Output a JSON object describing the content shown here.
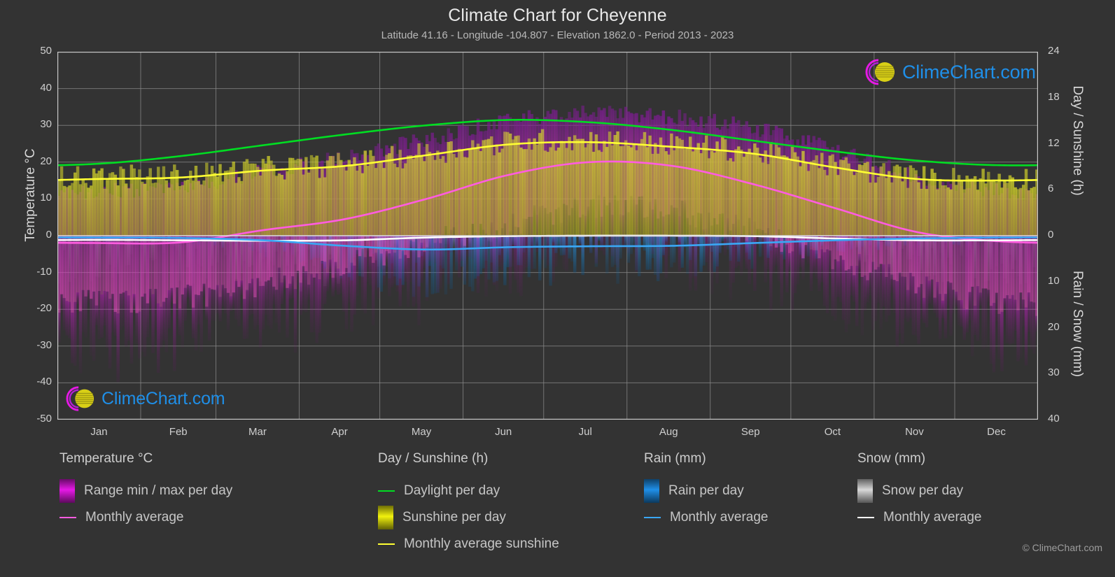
{
  "header": {
    "title": "Climate Chart for Cheyenne",
    "subtitle": "Latitude 41.16 - Longitude -104.807 - Elevation 1862.0 - Period 2013 - 2023"
  },
  "watermark": {
    "text": "ClimeChart.com"
  },
  "copyright": "© ClimeChart.com",
  "axes": {
    "left_title": "Temperature °C",
    "right_top_title": "Day / Sunshine (h)",
    "right_bottom_title": "Rain / Snow (mm)",
    "left_ticks": [
      "50",
      "40",
      "30",
      "20",
      "10",
      "0",
      "-10",
      "-20",
      "-30",
      "-40",
      "-50"
    ],
    "right_top_ticks": [
      "24",
      "18",
      "12",
      "6",
      "0"
    ],
    "right_bottom_ticks": [
      "0",
      "10",
      "20",
      "30",
      "40"
    ],
    "x_ticks": [
      "Jan",
      "Feb",
      "Mar",
      "Apr",
      "May",
      "Jun",
      "Jul",
      "Aug",
      "Sep",
      "Oct",
      "Nov",
      "Dec"
    ]
  },
  "colors": {
    "background": "#333333",
    "grid": "#8a8a8a",
    "axis": "#c8c8c8",
    "temp_range": "#e619e6",
    "temp_avg": "#ff5ce0",
    "daylight": "#00dd22",
    "sunshine": "#f2f20d",
    "sunshine_avg": "#ffff33",
    "rain": "#1f8fe8",
    "rain_avg": "#3aa7f5",
    "snow": "#d8d8d8",
    "snow_avg": "#ffffff",
    "logo_text": "#1f8fe8",
    "logo_arc": "#e619e6",
    "logo_sphere": "#e8e017"
  },
  "legend": {
    "columns": [
      {
        "title": "Temperature °C",
        "items": [
          {
            "type": "gradient",
            "label": "Range min / max per day",
            "color": "#e619e6"
          },
          {
            "type": "line",
            "label": "Monthly average",
            "color": "#ff5ce0"
          }
        ]
      },
      {
        "title": "Day / Sunshine (h)",
        "items": [
          {
            "type": "line",
            "label": "Daylight per day",
            "color": "#00dd22"
          },
          {
            "type": "gradient",
            "label": "Sunshine per day",
            "color": "#f2f20d"
          },
          {
            "type": "line",
            "label": "Monthly average sunshine",
            "color": "#ffff33"
          }
        ]
      },
      {
        "title": "Rain (mm)",
        "items": [
          {
            "type": "gradient",
            "label": "Rain per day",
            "color": "#1f8fe8"
          },
          {
            "type": "line",
            "label": "Monthly average",
            "color": "#3aa7f5"
          }
        ]
      },
      {
        "title": "Snow (mm)",
        "items": [
          {
            "type": "gradient",
            "label": "Snow per day",
            "color": "#d8d8d8"
          },
          {
            "type": "line",
            "label": "Monthly average",
            "color": "#ffffff"
          }
        ]
      }
    ]
  },
  "chart_data": {
    "type": "area",
    "title": "Climate Chart for Cheyenne",
    "subtitle": "Latitude 41.16 - Longitude -104.807 - Elevation 1862.0 - Period 2013 - 2023",
    "xlabel": "",
    "ylabel": "Temperature °C",
    "ylim": [
      -50,
      50
    ],
    "y2lim_top": [
      0,
      24
    ],
    "y2lim_bottom": [
      0,
      40
    ],
    "grid": true,
    "legend_position": "below",
    "categories": [
      "Jan",
      "Feb",
      "Mar",
      "Apr",
      "May",
      "Jun",
      "Jul",
      "Aug",
      "Sep",
      "Oct",
      "Nov",
      "Dec"
    ],
    "series": [
      {
        "name": "Temperature monthly average (°C)",
        "units": "°C",
        "color": "#ff5ce0",
        "values": [
          -2.0,
          -1.8,
          1.5,
          4.5,
          10.0,
          16.5,
          20.0,
          19.0,
          14.0,
          7.5,
          1.0,
          -1.5
        ]
      },
      {
        "name": "Temperature daily max envelope (°C)",
        "units": "°C",
        "color": "#e619e6",
        "values": [
          12.0,
          13.0,
          17.0,
          21.0,
          26.0,
          31.0,
          33.0,
          32.0,
          29.0,
          23.0,
          16.0,
          12.0
        ]
      },
      {
        "name": "Temperature daily min envelope (°C)",
        "units": "°C",
        "color": "#e619e6",
        "values": [
          -18.0,
          -17.0,
          -13.0,
          -8.0,
          -2.0,
          3.0,
          8.0,
          7.0,
          1.0,
          -6.0,
          -13.0,
          -18.0
        ]
      },
      {
        "name": "Daylight per day (h)",
        "units": "h",
        "color": "#00dd22",
        "values": [
          9.4,
          10.4,
          11.8,
          13.2,
          14.4,
          15.1,
          14.8,
          13.8,
          12.4,
          11.0,
          9.8,
          9.2
        ]
      },
      {
        "name": "Monthly average sunshine (h)",
        "units": "h",
        "color": "#ffff33",
        "values": [
          7.4,
          7.6,
          8.5,
          9.1,
          10.5,
          11.9,
          12.2,
          11.6,
          10.7,
          8.9,
          7.4,
          7.2
        ]
      },
      {
        "name": "Rain monthly average (mm)",
        "units": "mm",
        "color": "#3aa7f5",
        "values": [
          0.4,
          0.5,
          1.0,
          2.2,
          3.0,
          2.5,
          2.3,
          2.2,
          1.6,
          1.0,
          0.6,
          0.4
        ]
      },
      {
        "name": "Snow monthly average (mm)",
        "units": "mm",
        "color": "#ffffff",
        "values": [
          0.9,
          1.0,
          1.1,
          1.0,
          0.4,
          0.1,
          0.0,
          0.0,
          0.1,
          0.6,
          1.0,
          1.0
        ]
      }
    ]
  }
}
